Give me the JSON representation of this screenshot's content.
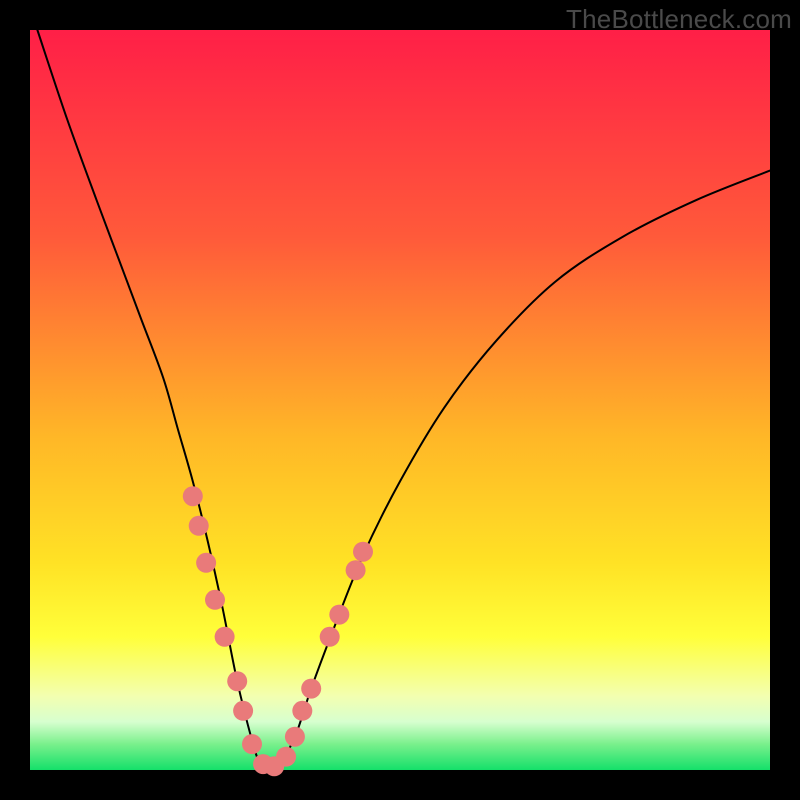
{
  "watermark": "TheBottleneck.com",
  "chart_data": {
    "type": "line",
    "title": "",
    "xlabel": "",
    "ylabel": "",
    "xlim": [
      0,
      100
    ],
    "ylim": [
      0,
      100
    ],
    "grid": false,
    "legend": false,
    "background": {
      "type": "vertical-gradient",
      "stops": [
        {
          "pos": 0.0,
          "color": "#ff1f47"
        },
        {
          "pos": 0.28,
          "color": "#ff5a3a"
        },
        {
          "pos": 0.55,
          "color": "#ffb727"
        },
        {
          "pos": 0.72,
          "color": "#ffe225"
        },
        {
          "pos": 0.82,
          "color": "#ffff3a"
        },
        {
          "pos": 0.9,
          "color": "#f3ffb0"
        },
        {
          "pos": 0.935,
          "color": "#d7ffcf"
        },
        {
          "pos": 0.965,
          "color": "#7af08c"
        },
        {
          "pos": 1.0,
          "color": "#14e06a"
        }
      ]
    },
    "series": [
      {
        "name": "curve",
        "color": "#000000",
        "stroke_width": 2,
        "x": [
          1,
          5,
          9,
          12,
          15,
          18,
          20,
          22,
          24,
          26,
          28,
          30,
          31,
          32,
          33,
          34,
          36,
          38,
          41,
          45,
          50,
          56,
          63,
          71,
          80,
          90,
          100
        ],
        "y": [
          100,
          88,
          77,
          69,
          61,
          53,
          46,
          39,
          31,
          22,
          12,
          4,
          1,
          0,
          0,
          1,
          5,
          11,
          19,
          29,
          39,
          49,
          58,
          66,
          72,
          77,
          81
        ]
      }
    ],
    "markers": {
      "name": "dots",
      "color": "#e97a7a",
      "radius": 10,
      "points": [
        {
          "x": 22.0,
          "y": 37
        },
        {
          "x": 22.8,
          "y": 33
        },
        {
          "x": 23.8,
          "y": 28
        },
        {
          "x": 25.0,
          "y": 23
        },
        {
          "x": 26.3,
          "y": 18
        },
        {
          "x": 28.0,
          "y": 12
        },
        {
          "x": 28.8,
          "y": 8
        },
        {
          "x": 30.0,
          "y": 3.5
        },
        {
          "x": 31.5,
          "y": 0.8
        },
        {
          "x": 33.0,
          "y": 0.5
        },
        {
          "x": 34.6,
          "y": 1.8
        },
        {
          "x": 35.8,
          "y": 4.5
        },
        {
          "x": 36.8,
          "y": 8
        },
        {
          "x": 38.0,
          "y": 11
        },
        {
          "x": 40.5,
          "y": 18
        },
        {
          "x": 41.8,
          "y": 21
        },
        {
          "x": 44.0,
          "y": 27
        },
        {
          "x": 45.0,
          "y": 29.5
        }
      ]
    }
  }
}
